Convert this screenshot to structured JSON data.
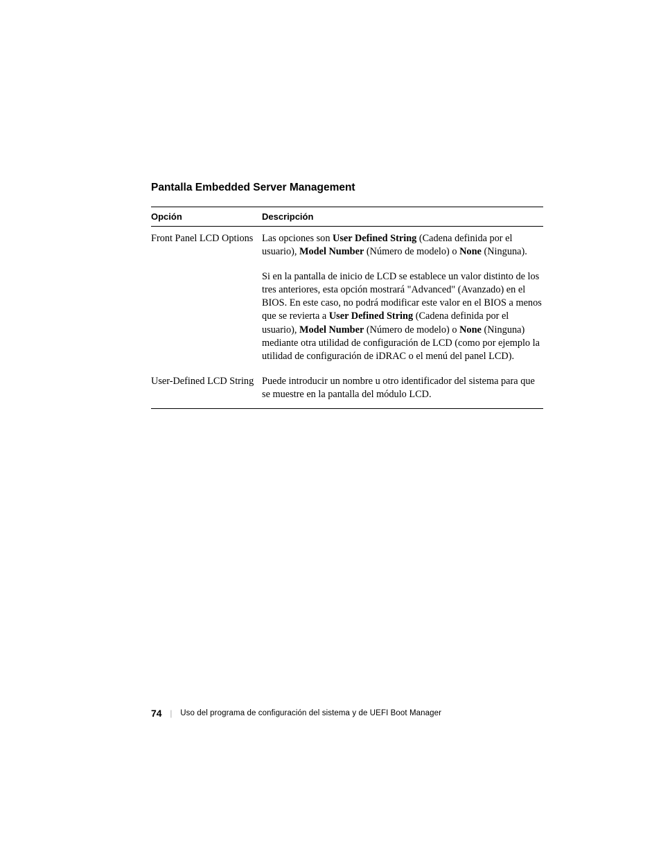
{
  "heading": "Pantalla Embedded Server Management",
  "table": {
    "headers": {
      "option": "Opción",
      "description": "Descripción"
    },
    "row1": {
      "option": "Front Panel LCD Options",
      "p1_a": "Las opciones son ",
      "p1_b": "User Defined String",
      "p1_c": " (Cadena definida por el usuario), ",
      "p1_d": "Model Number",
      "p1_e": " (Número de modelo) o ",
      "p1_f": "None",
      "p1_g": " (Ninguna).",
      "p2_a": "Si en la pantalla de inicio de LCD se establece un valor distinto de los tres anteriores, esta opción mostrará \"Advanced\" (Avanzado) en el BIOS. En este caso, no podrá modificar este valor en el BIOS a menos que se revierta a ",
      "p2_b": "User Defined String",
      "p2_c": " (Cadena definida por el usuario), ",
      "p2_d": "Model Number",
      "p2_e": " (Número de modelo) o ",
      "p2_f": "None",
      "p2_g": " (Ninguna) mediante otra utilidad de configuración de LCD (como por ejemplo la utilidad de configuración de iDRAC o el menú del panel LCD)."
    },
    "row2": {
      "option": "User-Defined LCD String",
      "desc": "Puede introducir un nombre u otro identificador del sistema para que se muestre en la pantalla del módulo LCD."
    }
  },
  "footer": {
    "page": "74",
    "text": "Uso del programa de configuración del sistema y de UEFI Boot Manager"
  }
}
